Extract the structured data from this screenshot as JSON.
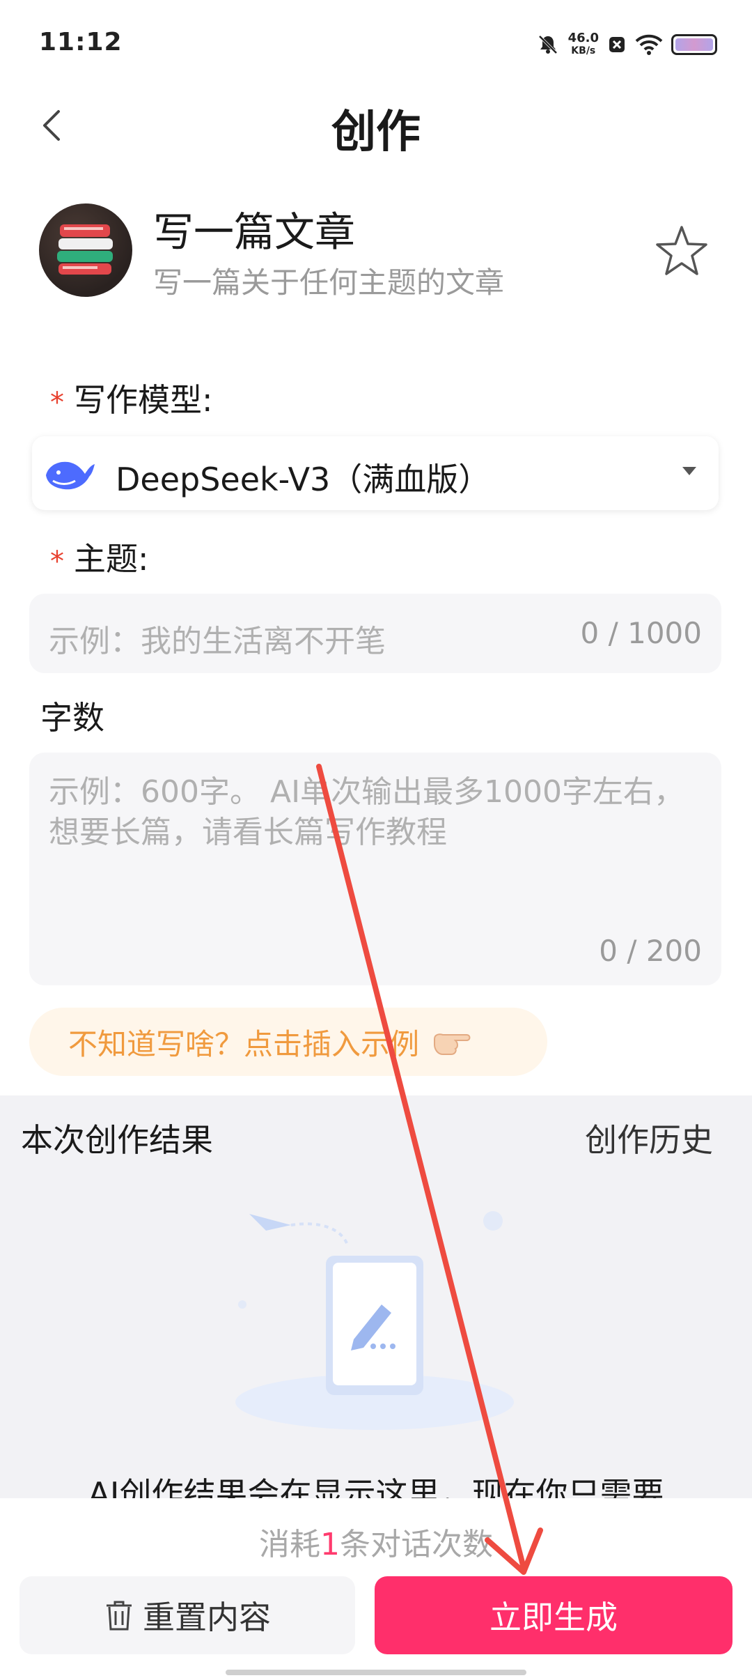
{
  "status_bar": {
    "time": "11:12",
    "net_speed_value": "46.0",
    "net_speed_unit": "KB/s"
  },
  "header": {
    "title": "创作"
  },
  "tool": {
    "name": "写一篇文章",
    "description": "写一篇关于任何主题的文章"
  },
  "form": {
    "model_label": "写作模型:",
    "required_mark": "*",
    "model_value": "DeepSeek-V3（满血版）",
    "topic_label": "主题:",
    "topic_placeholder": "示例：我的生活离不开笔",
    "topic_counter": "0 / 1000",
    "words_label": "字数",
    "words_placeholder": "示例：600字。 AI单次输出最多1000字左右，想要长篇，请看长篇写作教程",
    "words_counter": "0 / 200",
    "example_chip": "不知道写啥？点击插入示例"
  },
  "result": {
    "title": "本次创作结果",
    "history_link": "创作历史",
    "hint": "AI创作结果会在显示这里，现在你只需要"
  },
  "bottom": {
    "cost_prefix": "消耗",
    "cost_num": "1",
    "cost_suffix": "条对话次数",
    "reset_label": "重置内容",
    "generate_label": "立即生成"
  },
  "colors": {
    "accent": "#ff2f6b",
    "required": "#e8402e",
    "example_text": "#f09a3e",
    "annotation_arrow": "#ee4b40"
  },
  "icons": [
    "back-chevron-icon",
    "star-icon",
    "whale-logo-icon",
    "dropdown-caret-icon",
    "pointing-hand-icon",
    "trash-icon",
    "pen-doc-illustration"
  ]
}
